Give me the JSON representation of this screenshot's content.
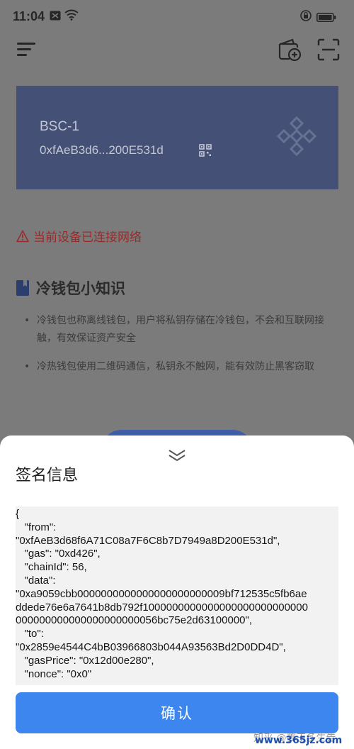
{
  "status_bar": {
    "time": "11:04"
  },
  "wallet": {
    "name": "BSC-1",
    "address": "0xfAeB3d6...200E531d"
  },
  "warning": {
    "text": "当前设备已连接网络"
  },
  "tips": {
    "title": "冷钱包小知识",
    "items": [
      "冷钱包也称离线钱包，用户将私钥存储在冷钱包，不会和互联网接触，有效保证资产安全",
      "冷热钱包使用二维码通信，私钥永不触网，能有效防止黑客窃取"
    ]
  },
  "sign_sheet": {
    "title": "签名信息",
    "payload_lines": [
      "{",
      "   \"from\":",
      "\"0xfAeB3d68f6A71C08a7F6C8b7D7949a8D200E531d\",",
      "   \"gas\": \"0xd426\",",
      "   \"chainId\": 56,",
      "   \"data\":",
      "\"0xa9059cbb0000000000000000000000009bf712535c5fb6ae",
      "ddede76e6a7641b8db792f1000000000000000000000000000",
      "000000000000000000000056bc75e2d63100000\",",
      "   \"to\":",
      "\"0x2859e4544C4bB03966803b044A93563Bd2D0DD4D\",",
      "   \"gasPrice\": \"0x12d00e280\",",
      "   \"nonce\": \"0x0\""
    ],
    "confirm_label": "确认"
  },
  "watermark": {
    "text": "知乎 @姜王多生告",
    "site": "www.365jz.com"
  },
  "colors": {
    "overlay_bg": "#7b7b7b",
    "card_bg": "#445076",
    "warning": "#9a2a2a",
    "primary": "#3d86f0"
  },
  "icons": [
    "menu-icon",
    "wallet-add-icon",
    "scan-icon",
    "qr-icon",
    "bnb-logo",
    "warning-icon",
    "book-icon",
    "collapse-icon"
  ]
}
